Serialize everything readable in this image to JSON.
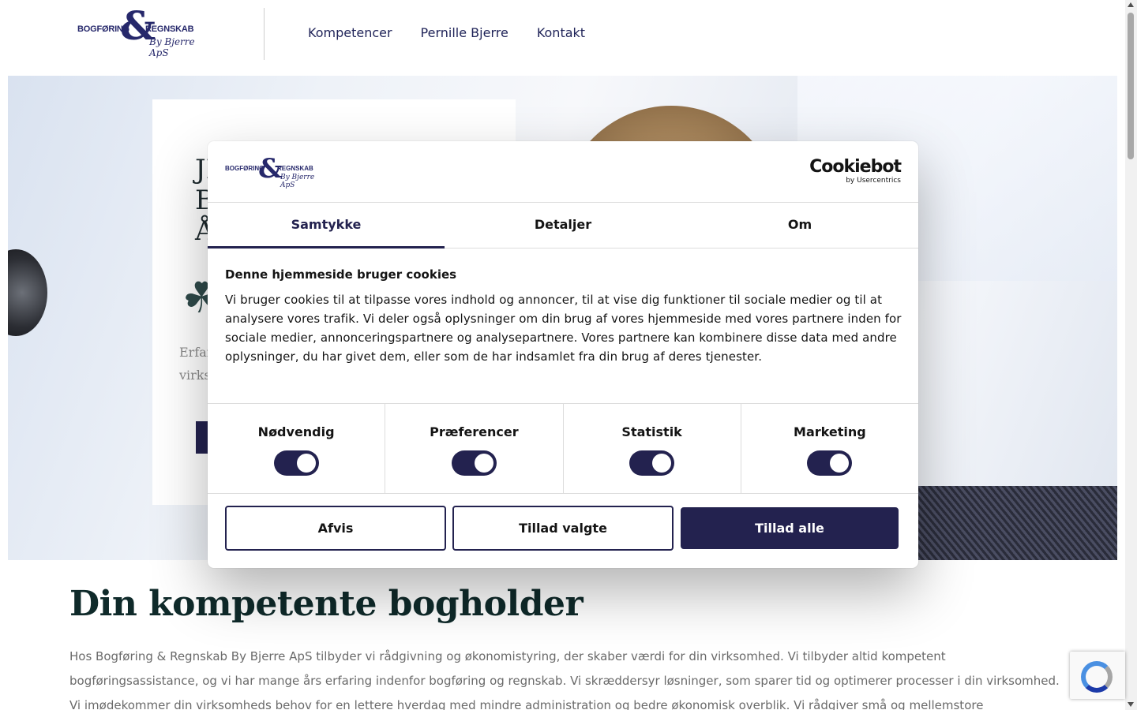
{
  "header": {
    "logo": {
      "line1": "BOGFØRING",
      "ampersand": "&",
      "line2": "REGNSKAB",
      "line3": "By Bjerre ApS"
    },
    "nav": [
      "Kompetencer",
      "Pernille Bjerre",
      "Kontakt"
    ]
  },
  "hero": {
    "heading_lines": [
      "JI",
      "B",
      "Å"
    ],
    "body_lines": [
      "Erfar",
      "virks"
    ]
  },
  "content": {
    "title": "Din kompetente bogholder",
    "text": "Hos Bogføring & Regnskab By Bjerre ApS tilbyder vi rådgivning og økonomistyring, der skaber værdi for din virksomhed. Vi tilbyder altid kompetent bogføringsassistance, og vi har mange års erfaring indenfor bogføring og regnskab. Vi skræddersyr løsninger, som sparer tid og optimerer processer i din virksomhed. Vi imødekommer din virksomheds behov for en lettere hverdag med mindre administration og bedre økonomisk overblik. Vi rådgiver små og mellemstore virksomheder i hele Danmark."
  },
  "cookie_dialog": {
    "logo": {
      "line1": "BOGFØRING",
      "ampersand": "&",
      "line2": "REGNSKAB",
      "line3": "By Bjerre ApS"
    },
    "brand": {
      "name": "Cookiebot",
      "sub": "by Usercentrics"
    },
    "tabs": [
      "Samtykke",
      "Detaljer",
      "Om"
    ],
    "active_tab": "Samtykke",
    "title": "Denne hjemmeside bruger cookies",
    "text": "Vi bruger cookies til at tilpasse vores indhold og annoncer, til at vise dig funktioner til sociale medier og til at analysere vores trafik. Vi deler også oplysninger om din brug af vores hjemmeside med vores partnere inden for sociale medier, annonceringspartnere og analysepartnere. Vores partnere kan kombinere disse data med andre oplysninger, du har givet dem, eller som de har indsamlet fra din brug af deres tjenester.",
    "toggles": [
      {
        "label": "Nødvendig",
        "on": true
      },
      {
        "label": "Præferencer",
        "on": true
      },
      {
        "label": "Statistik",
        "on": true
      },
      {
        "label": "Marketing",
        "on": true
      }
    ],
    "buttons": {
      "deny": "Afvis",
      "allow_selected": "Tillad valgte",
      "allow_all": "Tillad alle"
    }
  },
  "colors": {
    "brand_navy": "#23224f",
    "logo_blue": "#26286b",
    "title_green": "#0f2a2a",
    "body_gray": "#6a6a6a"
  },
  "icons": {
    "hero_clover": "clover-icon",
    "recaptcha": "recaptcha-icon"
  }
}
